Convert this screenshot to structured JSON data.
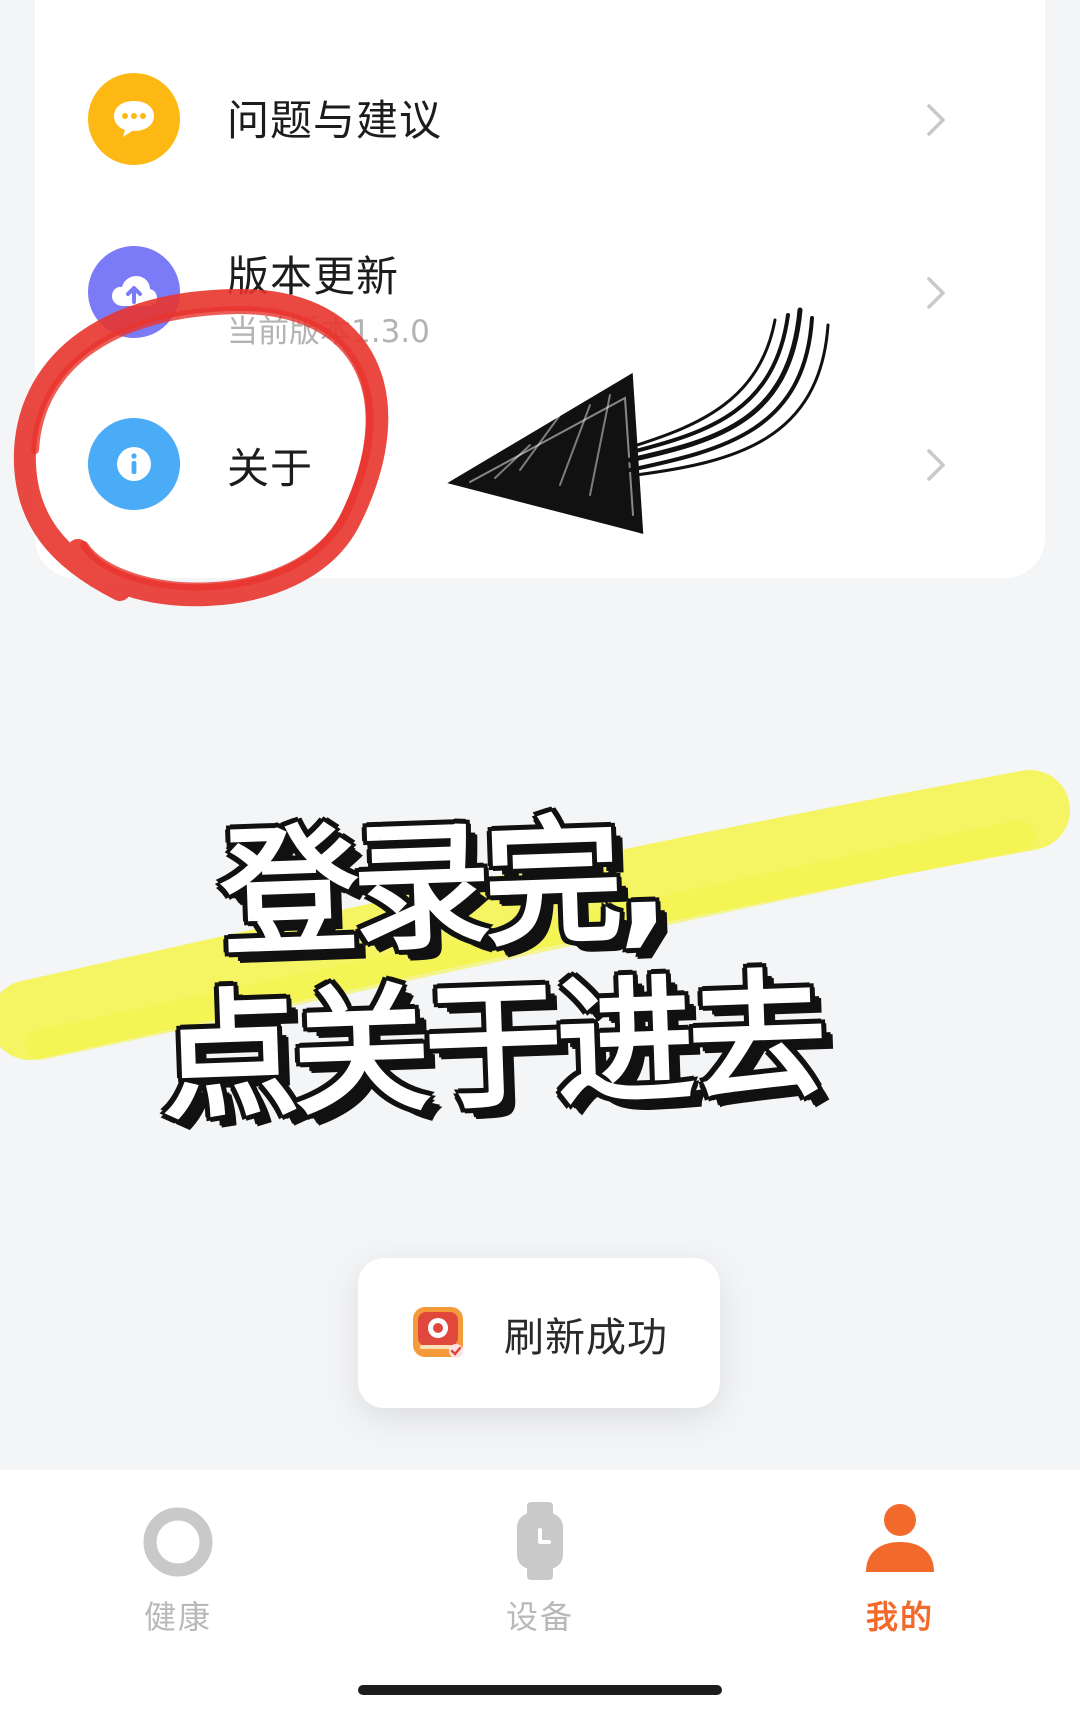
{
  "menu": {
    "items": [
      {
        "title": "问题与建议",
        "icon": "chat-bubble-icon",
        "icon_color": "#FDB813"
      },
      {
        "title": "版本更新",
        "subtitle": "当前版本1.3.0",
        "icon": "cloud-upload-icon",
        "icon_color": "#7C7BF7"
      },
      {
        "title": "关于",
        "icon": "info-icon",
        "icon_color": "#4AABF7"
      }
    ]
  },
  "annotation": {
    "caption_line1": "登录完,",
    "caption_line2": "点关于进去",
    "highlight_color": "#F4F54A",
    "circle_color": "#E8352D"
  },
  "toast": {
    "text": "刷新成功",
    "icon": "app-logo-icon"
  },
  "tabbar": {
    "active_color": "#F26A2B",
    "tabs": [
      {
        "label": "健康",
        "icon": "ring-icon",
        "active": false
      },
      {
        "label": "设备",
        "icon": "watch-icon",
        "active": false
      },
      {
        "label": "我的",
        "icon": "person-icon",
        "active": true
      }
    ]
  }
}
